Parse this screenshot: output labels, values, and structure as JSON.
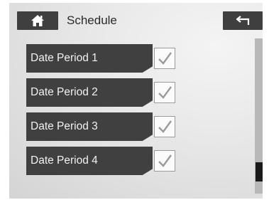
{
  "header": {
    "title": "Schedule",
    "home_icon": "home-icon",
    "back_icon": "back-arrow-icon"
  },
  "periods": [
    {
      "label": "Date Period 1",
      "checked": true
    },
    {
      "label": "Date Period 2",
      "checked": true
    },
    {
      "label": "Date Period 3",
      "checked": true
    },
    {
      "label": "Date Period 4",
      "checked": true
    }
  ],
  "scrollbar": {
    "position": "bottom"
  },
  "colors": {
    "button_bg": "#3f3f3f",
    "row_bg": "#404040",
    "row_text": "#f2f2f2",
    "checkmark": "#9a9a9a",
    "scroll_thumb": "#1a1a1a"
  }
}
